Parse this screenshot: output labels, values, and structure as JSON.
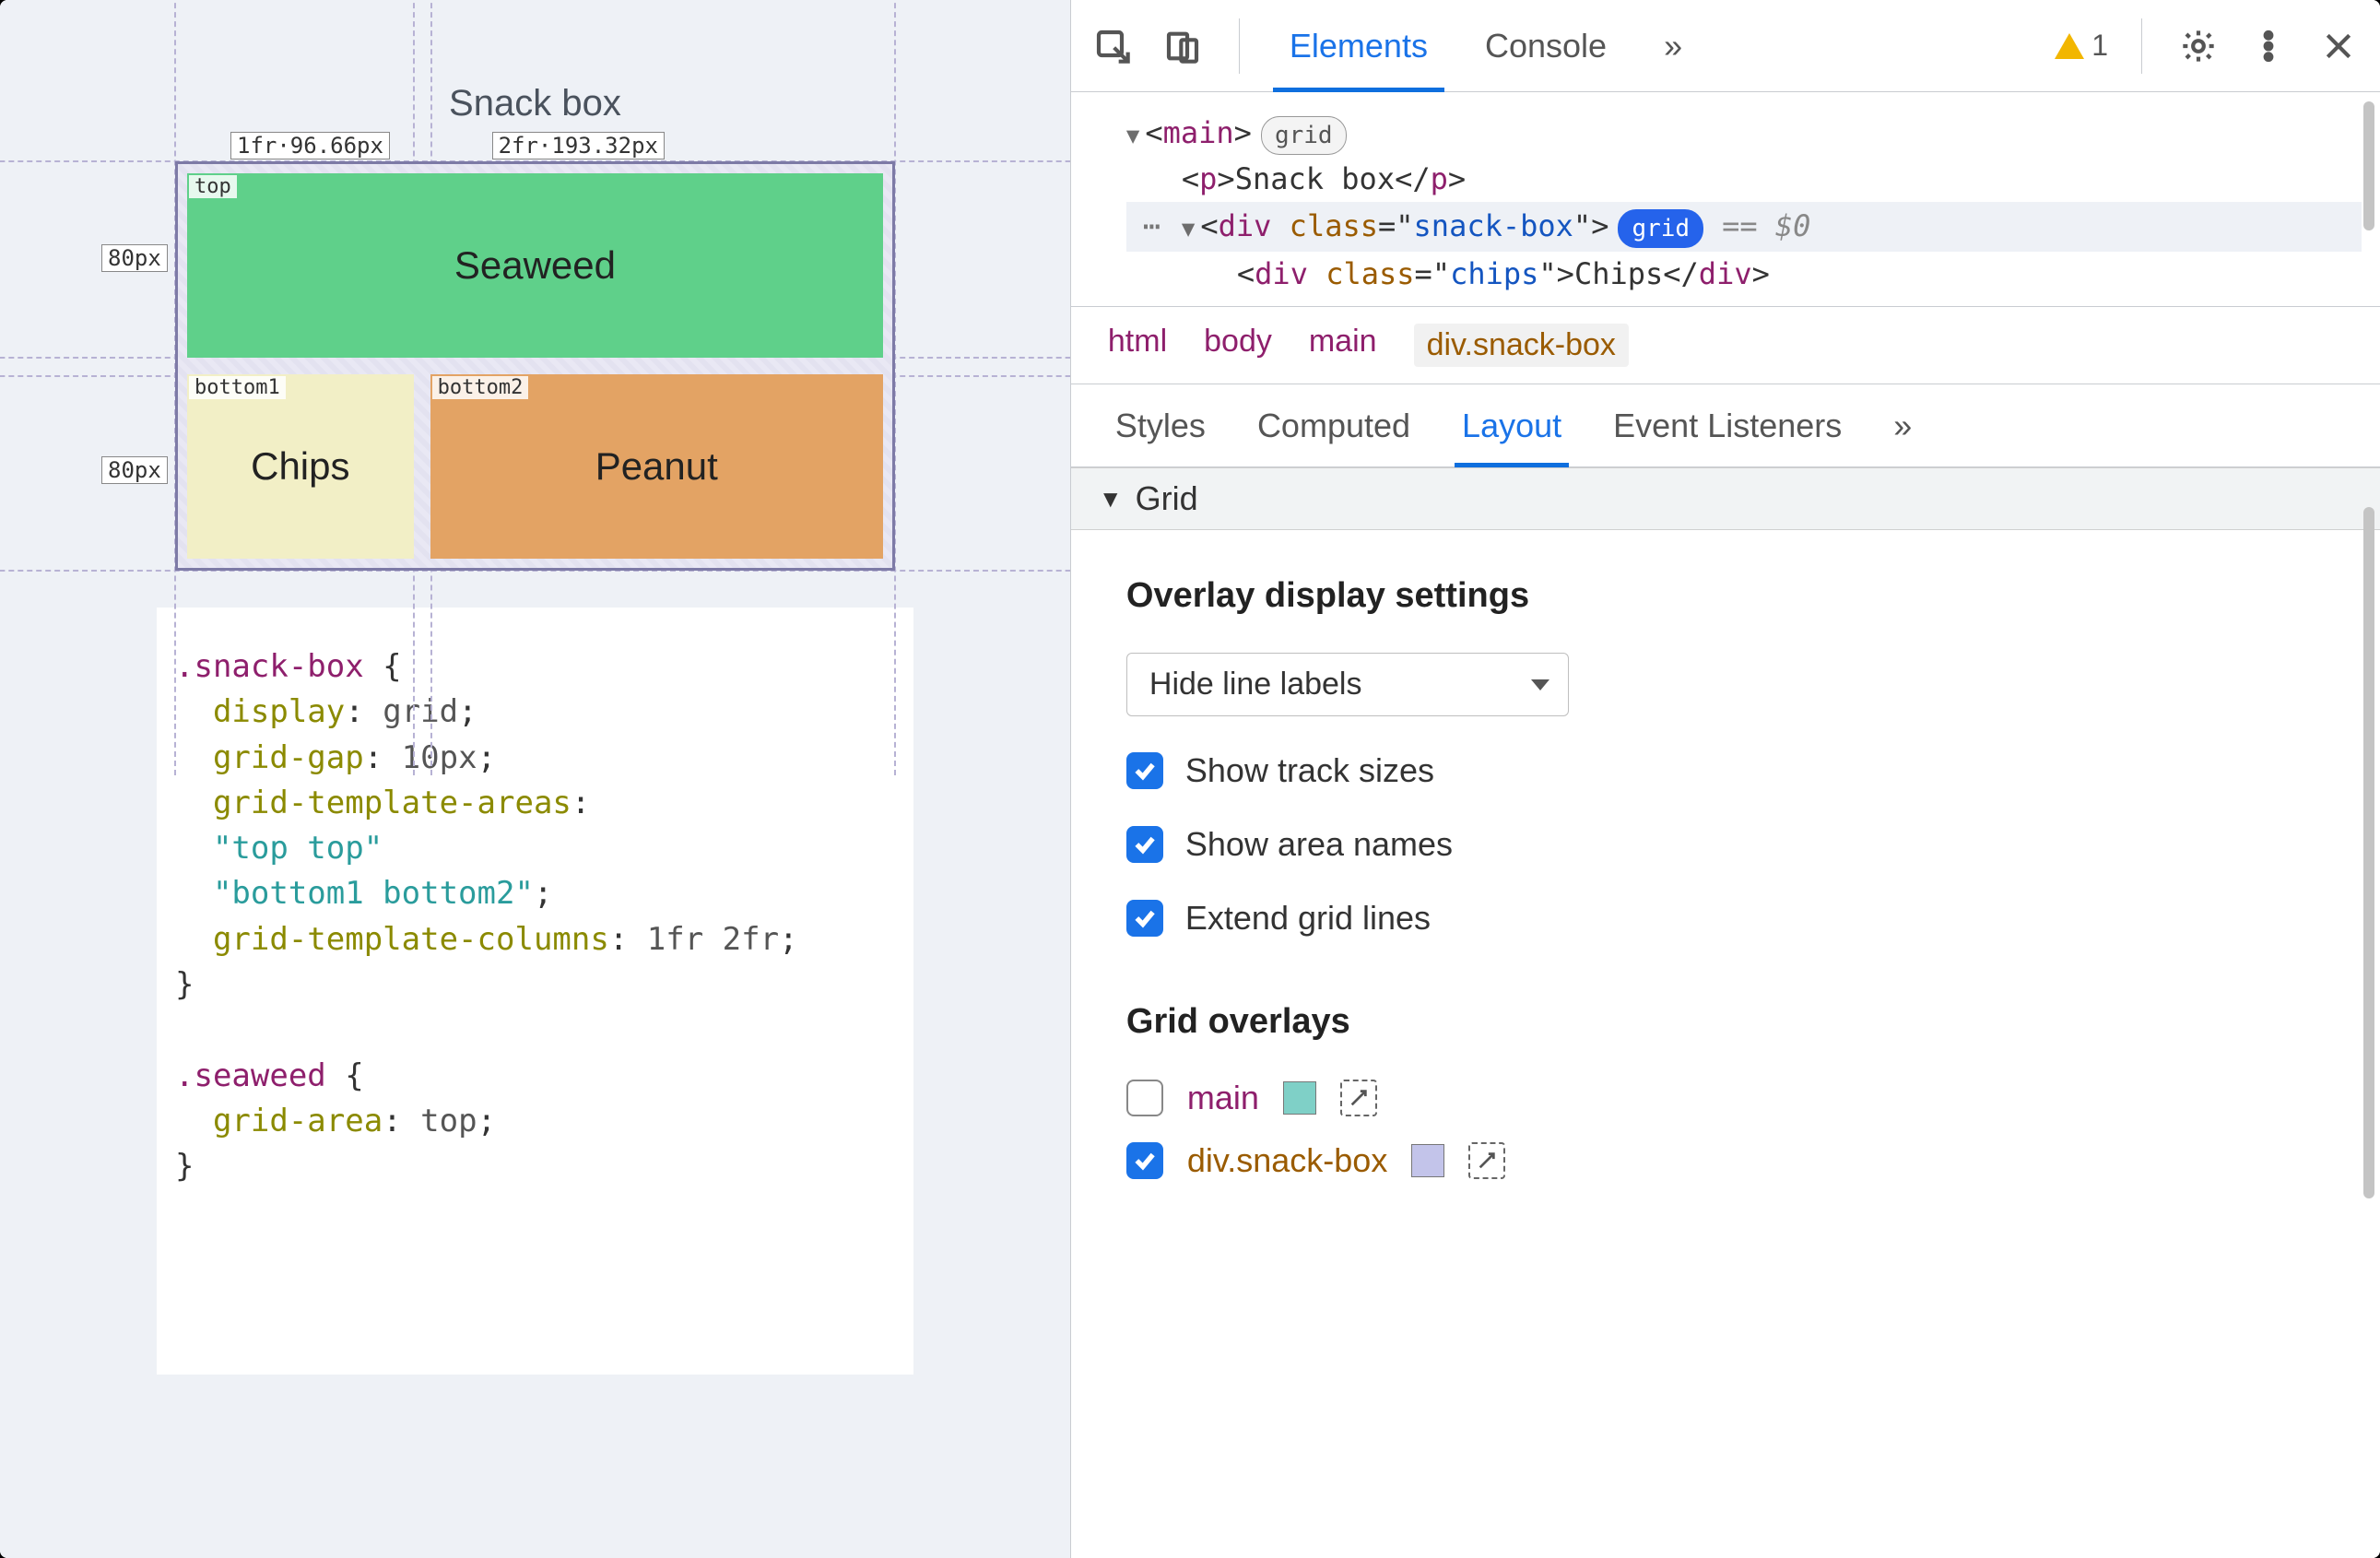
{
  "preview": {
    "title": "Snack box",
    "cols": [
      "1fr·96.66px",
      "2fr·193.32px"
    ],
    "rows": [
      "80px",
      "80px"
    ],
    "areas": {
      "top": "top",
      "b1": "bottom1",
      "b2": "bottom2"
    },
    "cells": {
      "seaweed": "Seaweed",
      "chips": "Chips",
      "peanut": "Peanut"
    }
  },
  "code": {
    "sel1": ".snack-box",
    "p_display": "display",
    "v_display": "grid",
    "p_gap": "grid-gap",
    "v_gap": "10px",
    "p_areas": "grid-template-areas",
    "s_top": "\"top top\"",
    "s_bot": "\"bottom1 bottom2\"",
    "p_cols": "grid-template-columns",
    "v_cols": "1fr 2fr",
    "sel2": ".seaweed",
    "p_area": "grid-area",
    "v_area": "top"
  },
  "devtools": {
    "tabs": {
      "elements": "Elements",
      "console": "Console"
    },
    "more": "»",
    "warn_count": "1",
    "dom": {
      "main_open": "main",
      "grid_pill": "grid",
      "p_text": "Snack box",
      "div_class": "snack-box",
      "eq": "== $0",
      "chips_class": "chips",
      "chips_text": "Chips"
    },
    "crumbs": [
      "html",
      "body",
      "main",
      "div.snack-box"
    ],
    "subtabs": {
      "styles": "Styles",
      "computed": "Computed",
      "layout": "Layout",
      "events": "Event Listeners"
    },
    "grid_head": "Grid",
    "overlay_title": "Overlay display settings",
    "select_label": "Hide line labels",
    "checks": {
      "track": "Show track sizes",
      "area": "Show area names",
      "extend": "Extend grid lines"
    },
    "overlays_title": "Grid overlays",
    "overlay_items": {
      "main": "main",
      "snack": "div.snack-box"
    }
  }
}
